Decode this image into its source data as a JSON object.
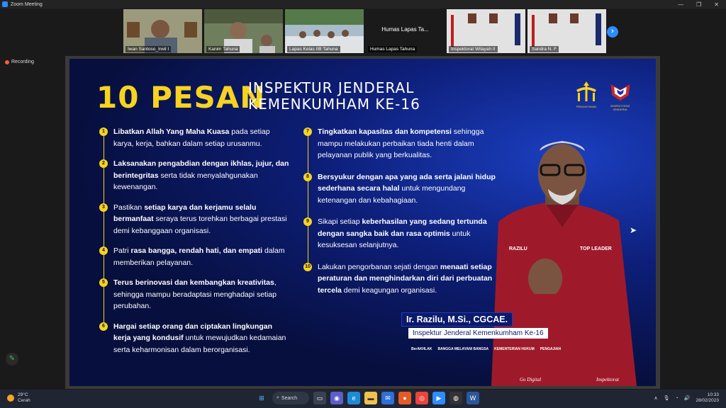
{
  "window": {
    "title": "Zoom Meeting",
    "controls": [
      "—",
      "❐",
      "✕"
    ]
  },
  "recording_label": "Recording",
  "participants": [
    {
      "name": "Iwan Santoso_Irwil I",
      "bg": "#8a8a6a"
    },
    {
      "name": "Kanim Tahuna",
      "bg": "#6f7e5c"
    },
    {
      "name": "Lapas Kelas IIB Tahuna",
      "bg": "#8fa3b0"
    },
    {
      "name": "Humas Lapas Tahuna",
      "center": "Humas Lapas Ta...",
      "bg": "#1a1a1a"
    },
    {
      "name": "Inspektorat Wilayah II",
      "bg": "#d9d9d9"
    },
    {
      "name": "Sandra N. F",
      "bg": "#d9d9d9"
    }
  ],
  "slide": {
    "title_big": "10 PESAN",
    "title_line1": "INSPEKTUR JENDERAL",
    "title_line2": "KEMENKUMHAM KE-16",
    "logo1_caption": "PENGAYOMAN",
    "logo2_caption": "INSPEKTORAT JENDERAL",
    "items": [
      {
        "num": "1",
        "bold": "Libatkan Allah Yang Maha Kuasa",
        "text": " pada setiap karya, kerja, bahkan dalam setiap urusanmu."
      },
      {
        "num": "2",
        "bold": "Laksanakan pengabdian dengan ikhlas, jujur, dan berintegritas",
        "text": " serta tidak menyalahgunakan kewenangan."
      },
      {
        "num": "3",
        "pre": "Pastikan ",
        "bold": "setiap karya dan kerjamu selalu bermanfaat",
        "text": " seraya terus torehkan berbagai prestasi demi kebanggaan organisasi."
      },
      {
        "num": "4",
        "pre": "Patri ",
        "bold": "rasa bangga, rendah hati, dan empati",
        "text": " dalam memberikan pelayanan."
      },
      {
        "num": "5",
        "bold": "Terus berinovasi dan kembangkan kreativitas",
        "text": ", sehingga mampu beradaptasi menghadapi setiap perubahan."
      },
      {
        "num": "6",
        "bold": "Hargai setiap orang dan ciptakan lingkungan kerja yang kondusif",
        "text": " untuk mewujudkan kedamaian serta keharmonisan dalam berorganisasi."
      },
      {
        "num": "7",
        "bold": "Tingkatkan kapasitas dan kompetensi",
        "text": " sehingga mampu melakukan perbaikan tiada henti dalam pelayanan publik yang berkualitas."
      },
      {
        "num": "8",
        "bold": "Bersyukur dengan apa yang ada serta jalani hidup sederhana secara halal",
        "text": " untuk mengundang ketenangan dan kebahagiaan."
      },
      {
        "num": "9",
        "pre": "Sikapi setiap ",
        "bold": "keberhasilan yang sedang tertunda dengan sangka baik dan rasa optimis",
        "text": " untuk kesuksesan selanjutnya."
      },
      {
        "num": "10",
        "pre": "Lakukan pengorbanan sejati dengan ",
        "bold": "menaati setiap peraturan dan menghindarkan diri dari perbuatan tercela",
        "text": " demi keagungan organisasi."
      }
    ],
    "person_name": "Ir. Razilu, M.Si., CGCAE.",
    "person_role": "Inspektur Jenderal Kemenkumham Ke-16",
    "shirt_left": "RAZILU",
    "shirt_right": "TOP LEADER",
    "shirt_bottom_left": "Go Digital",
    "shirt_bottom_right": "Inspektorat",
    "bottom_logos": [
      "BerAKHLAK",
      "BANGGA MELAYANI BANGSA",
      "KEMENTERIAN HUKUM",
      "PENGAJIAN"
    ]
  },
  "taskbar": {
    "temp": "29°C",
    "weather": "Cerah",
    "search": "Search",
    "time": "10:33",
    "date": "28/02/2023"
  }
}
